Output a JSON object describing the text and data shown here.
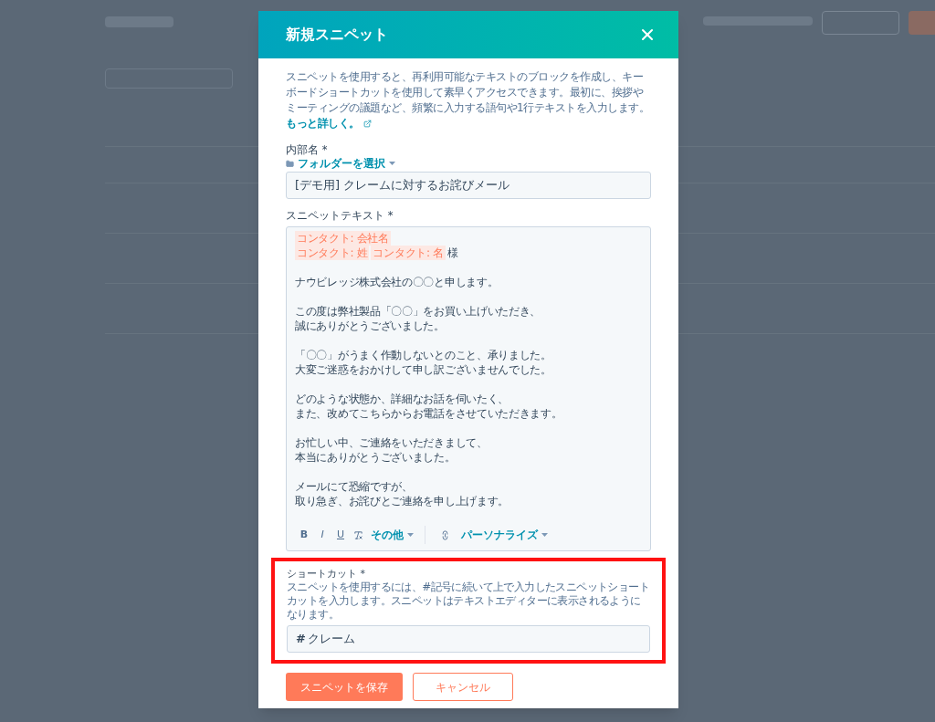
{
  "dialog": {
    "title": "新規スニペット",
    "intro": "スニペットを使用すると、再利用可能なテキストのブロックを作成し、キーボードショートカットを使用して素早くアクセスできます。最初に、挨拶やミーティングの議題など、頻繁に入力する語句や1行テキストを入力します。",
    "learn_more": "もっと詳しく。",
    "internal_name": {
      "label": "内部名 *",
      "folder_picker": "フォルダーを選択",
      "value": "[デモ用] クレームに対するお詫びメール"
    },
    "snippet_text": {
      "label": "スニペットテキスト *",
      "paragraphs": [
        [
          [
            {
              "kind": "token",
              "text": "コンタクト: 会社名"
            }
          ],
          [
            {
              "kind": "token",
              "text": "コンタクト: 姓"
            },
            {
              "kind": "token",
              "text": "コンタクト: 名"
            },
            {
              "kind": "plain",
              "text": "様"
            }
          ]
        ],
        [
          [
            {
              "kind": "plain",
              "text": "ナウビレッジ株式会社の〇〇と申します。"
            }
          ]
        ],
        [
          [
            {
              "kind": "plain",
              "text": "この度は弊社製品「〇〇」をお買い上げいただき、"
            }
          ],
          [
            {
              "kind": "plain",
              "text": "誠にありがとうございました。"
            }
          ]
        ],
        [
          [
            {
              "kind": "plain",
              "text": "「〇〇」がうまく作動しないとのこと、承りました。"
            }
          ],
          [
            {
              "kind": "plain",
              "text": "大変ご迷惑をおかけして申し訳ございませんでした。"
            }
          ]
        ],
        [
          [
            {
              "kind": "plain",
              "text": "どのような状態か、詳細なお話を伺いたく、"
            }
          ],
          [
            {
              "kind": "plain",
              "text": "また、改めてこちらからお電話をさせていただきます。"
            }
          ]
        ],
        [
          [
            {
              "kind": "plain",
              "text": "お忙しい中、ご連絡をいただきまして、"
            }
          ],
          [
            {
              "kind": "plain",
              "text": "本当にありがとうございました。"
            }
          ]
        ],
        [
          [
            {
              "kind": "plain",
              "text": "メールにて恐縮ですが、"
            }
          ],
          [
            {
              "kind": "plain",
              "text": "取り急ぎ、お詫びとご連絡を申し上げます。"
            }
          ]
        ]
      ],
      "toolbar": [
        {
          "kind": "bold",
          "text": "B"
        },
        {
          "kind": "italic",
          "text": "I"
        },
        {
          "kind": "underline",
          "text": "U"
        },
        {
          "kind": "clear"
        },
        {
          "kind": "menu",
          "text": "その他"
        },
        {
          "kind": "divider"
        },
        {
          "kind": "link"
        },
        {
          "kind": "menu",
          "text": "パーソナライズ"
        }
      ]
    },
    "shortcut": {
      "label": "ショートカット *",
      "help": "スニペットを使用するには、#記号に続いて上で入力したスニペットショートカットを入力します。スニペットはテキストエディターに表示されるようになります。",
      "prefix": "#",
      "value": "クレーム",
      "highlighted": true
    },
    "buttons": [
      {
        "kind": "primary",
        "text": "スニペットを保存"
      },
      {
        "kind": "secondary",
        "text": "キャンセル"
      }
    ]
  }
}
